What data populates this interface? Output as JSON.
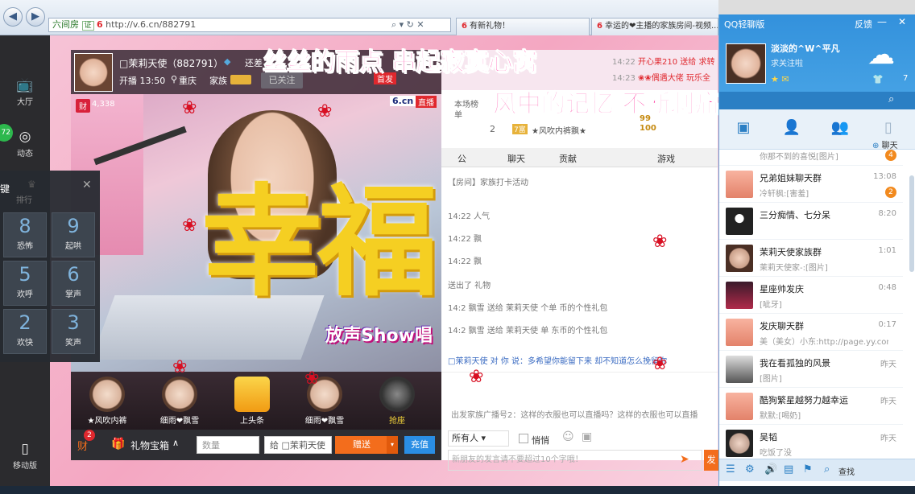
{
  "browser": {
    "addr_prefix": "六间房",
    "addr_tag": "证",
    "url": "http://v.6.cn/882791",
    "tabs": [
      {
        "logo": "6",
        "label": "有新礼物！"
      },
      {
        "logo": "6",
        "label": "幸运的❤主播的家族房间-视频..."
      }
    ]
  },
  "leftbar": {
    "items": [
      {
        "icon": "tv-icon",
        "label": "大厅"
      },
      {
        "icon": "compass-icon",
        "label": "动态",
        "badge": "72"
      },
      {
        "icon": "crown-icon",
        "label": "排行"
      },
      {
        "icon": "phone-icon",
        "label": "移动版"
      }
    ],
    "key_label": "键",
    "keys": [
      {
        "num": "8",
        "text": "恐怖"
      },
      {
        "num": "9",
        "text": "起哄"
      },
      {
        "num": "5",
        "text": "欢呼"
      },
      {
        "num": "6",
        "text": "掌声"
      },
      {
        "num": "2",
        "text": "欢快"
      },
      {
        "num": "3",
        "text": "笑声"
      }
    ]
  },
  "streamer": {
    "name": "□茉莉天使（882791）",
    "extra": "还差",
    "time": "开播 13:50",
    "location": "重庆",
    "family_label": "家族",
    "family_tag": " ",
    "follow_btn": "已关注",
    "wealth_label": "财",
    "wealth": "4,338",
    "logo": "6.cn",
    "live_tag": "直播",
    "badge": "首发"
  },
  "lyrics": {
    "line1": "丝丝的雨点  串起寂寞心窝",
    "line2": "风中的记忆  不断刺痛着我"
  },
  "effect_text": "幸福",
  "show_logo": "放声Show唱",
  "chat": {
    "top": [
      {
        "time": "14:22",
        "text": "开心果210 送给 求转"
      },
      {
        "time": "14:23",
        "text": "❀❀偶遇大佬 玩乐全"
      }
    ],
    "rank_label": "本场榜单",
    "rank_num": "2",
    "rank_badge": "7富",
    "rank_user": "★风吹内裤飘★",
    "rank_val1": "99",
    "rank_val2": "100",
    "tabs": [
      "公",
      "聊天",
      "贡献",
      "游戏"
    ],
    "lines": [
      {
        "time": "",
        "text": "【房间】家族打卡活动"
      },
      {
        "time": "14:22",
        "text": "人气"
      },
      {
        "time": "14:22",
        "text": "飘"
      },
      {
        "time": "14:22",
        "text": "飘"
      },
      {
        "time": "",
        "text": "送出了 礼物"
      },
      {
        "time": "14:2",
        "text": "飘雪 送给 茉莉天使 个单 币的个性礼包"
      },
      {
        "time": "14:2",
        "text": "飘雪 送给 茉莉天使 单 东币的个性礼包"
      }
    ],
    "message": "□茉莉天使 对 你 说：多希望你能留下来 却不知道怎么挽留你",
    "broadcast": "出发家族广播号2：这样的衣服也可以直播吗？这样的衣服也可以直播",
    "to_label": "所有人",
    "whisper": "悄悄",
    "input_placeholder": "新朋友的发言请不要超过10个字哦！",
    "send": "发"
  },
  "gifts": [
    {
      "label": "★风吹内裤"
    },
    {
      "label": "细雨❤飘雪"
    },
    {
      "label": "上头条"
    },
    {
      "label": "细雨❤飘雪"
    },
    {
      "label": "抢座"
    }
  ],
  "bottombar": {
    "wealth_badge": "2",
    "wealth": "财",
    "gift_box": "礼物宝箱",
    "qty_placeholder": "数量",
    "to_target": "给 □茉莉天使",
    "give_btn": "赠送",
    "recharge_btn": "充值"
  },
  "qq": {
    "title": "QQ轻聊版",
    "feedback": "反馈",
    "nickname": "淡淡的^W^平凡",
    "signature": "求关注啦",
    "weather_num": "7",
    "chat_btn": "聊天",
    "contacts": [
      {
        "name": "",
        "sub": "你那不到的喜悦[图片]",
        "time": "",
        "badge": "4"
      },
      {
        "name": "兄弟姐妹聊天群",
        "sub": "冷轩枫:[害羞]",
        "time": "13:08",
        "badge": "2"
      },
      {
        "name": "三分痴情、七分呆",
        "sub": "",
        "time": "8:20",
        "badge": ""
      },
      {
        "name": "茉莉天使家族群",
        "sub": "茉莉天使家-:[图片]",
        "time": "1:01",
        "badge": ""
      },
      {
        "name": "星座帅发庆",
        "sub": "[呲牙]",
        "time": "0:48",
        "badge": ""
      },
      {
        "name": "发庆聊天群",
        "sub": "美（美女）小东:http://page.yy.com/sh",
        "time": "0:17",
        "badge": ""
      },
      {
        "name": "我在看孤独的风景",
        "sub": "[图片]",
        "time": "昨天",
        "badge": ""
      },
      {
        "name": "酷狗繁星越努力越幸运",
        "sub": "默默:[喝奶]",
        "time": "昨天",
        "badge": ""
      },
      {
        "name": "吴韬",
        "sub": "吃饭了没",
        "time": "昨天",
        "badge": ""
      }
    ],
    "search": "查找"
  },
  "colors": {
    "accent_pink": "#ff2e9a",
    "qq_blue": "#3391dc",
    "gold": "#f5cf22",
    "orange": "#f36d1c"
  }
}
